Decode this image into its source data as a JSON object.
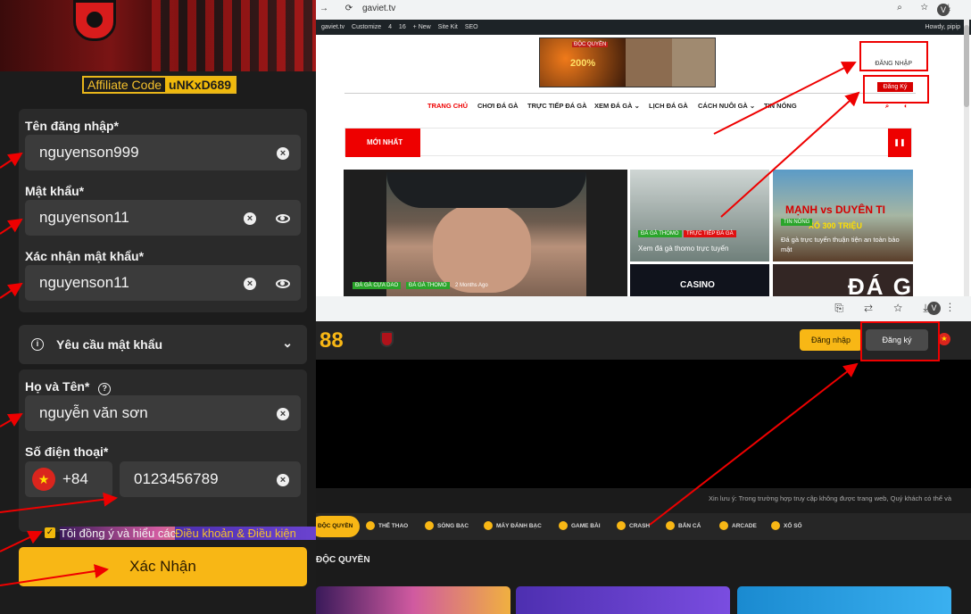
{
  "left_form": {
    "affiliate_label": "Affiliate Code",
    "affiliate_code": "uNKxD689",
    "username_label": "Tên đăng nhập*",
    "username_value": "nguyenson999",
    "password_label": "Mật khẩu*",
    "password_value": "nguyenson11",
    "confirm_label": "Xác nhận mật khẩu*",
    "confirm_value": "nguyenson11",
    "password_req": "Yêu cầu mật khẩu",
    "fullname_label": "Họ và Tên*",
    "fullname_value": "nguyễn văn sơn",
    "phone_label": "Số điện thoại*",
    "country_code": "+84",
    "phone_value": "0123456789",
    "agree_text": "Tôi đồng ý và hiểu các",
    "terms_link": "Điều khoản & Điều kiện",
    "submit_label": "Xác Nhận"
  },
  "gaviet": {
    "url": "gaviet.tv",
    "wp_site": "gaviet.tv",
    "wp_customize": "Customize",
    "wp_comments": "4",
    "wp_pending": "16",
    "wp_new": "+ New",
    "wp_sitekit": "Site Kit",
    "wp_seo": "SEO",
    "wp_howdy": "Howdy, pipip",
    "ad_tag": "ĐỘC QUYỀN",
    "ad_promo": "200%",
    "login_link": "ĐĂNG NHẬP",
    "register_link": "Đăng Ký",
    "menu": [
      "TRANG CHỦ",
      "CHƠI ĐÁ GÀ",
      "TRỰC TIẾP ĐÁ GÀ",
      "XEM ĐÁ GÀ ⌄",
      "LỊCH ĐÁ GÀ",
      "CÁCH NUÔI GÀ ⌄",
      "TIN NÓNG"
    ],
    "newest_label": "MỚI NHẤT",
    "post1_tags": [
      "ĐÁ GÀ CỰA DAO",
      "ĐÁ GÀ THOMO"
    ],
    "post1_time": "2 Months Ago",
    "post2_tags": [
      "ĐÁ GÀ THOMO",
      "TRỰC TIẾP ĐÁ GÀ"
    ],
    "post2_title": "Xem đá gà thomo trực tuyến",
    "post3_tag": "TIN NÓNG",
    "post3_banner1": "MẠNH vs DUYÊN TI",
    "post3_banner2": "XỔ 300 TRIỆU",
    "post3_title": "Đá gà trực tuyến thuận tiện an toàn bảo mật",
    "post4_text": "CASINO",
    "post5_text": "ĐÁ G"
  },
  "site88": {
    "logo": "88",
    "login_button": "Đăng nhập",
    "register_button": "Đăng ký",
    "notice": "Xin lưu ý: Trong trường hợp truy cập không được trang web, Quý khách có thể và",
    "categories": [
      "ĐỘC QUYỀN",
      "THỂ THAO",
      "SÒNG BẠC",
      "MÁY ĐÁNH BẠC",
      "GAME BÀI",
      "CRASH",
      "BẮN CÁ",
      "ARCADE",
      "XỔ SỐ"
    ],
    "section_title": "ĐỘC QUYỀN"
  },
  "colors": {
    "accent": "#f8b715",
    "annotation": "#e00000",
    "brand_red": "#e00000"
  }
}
